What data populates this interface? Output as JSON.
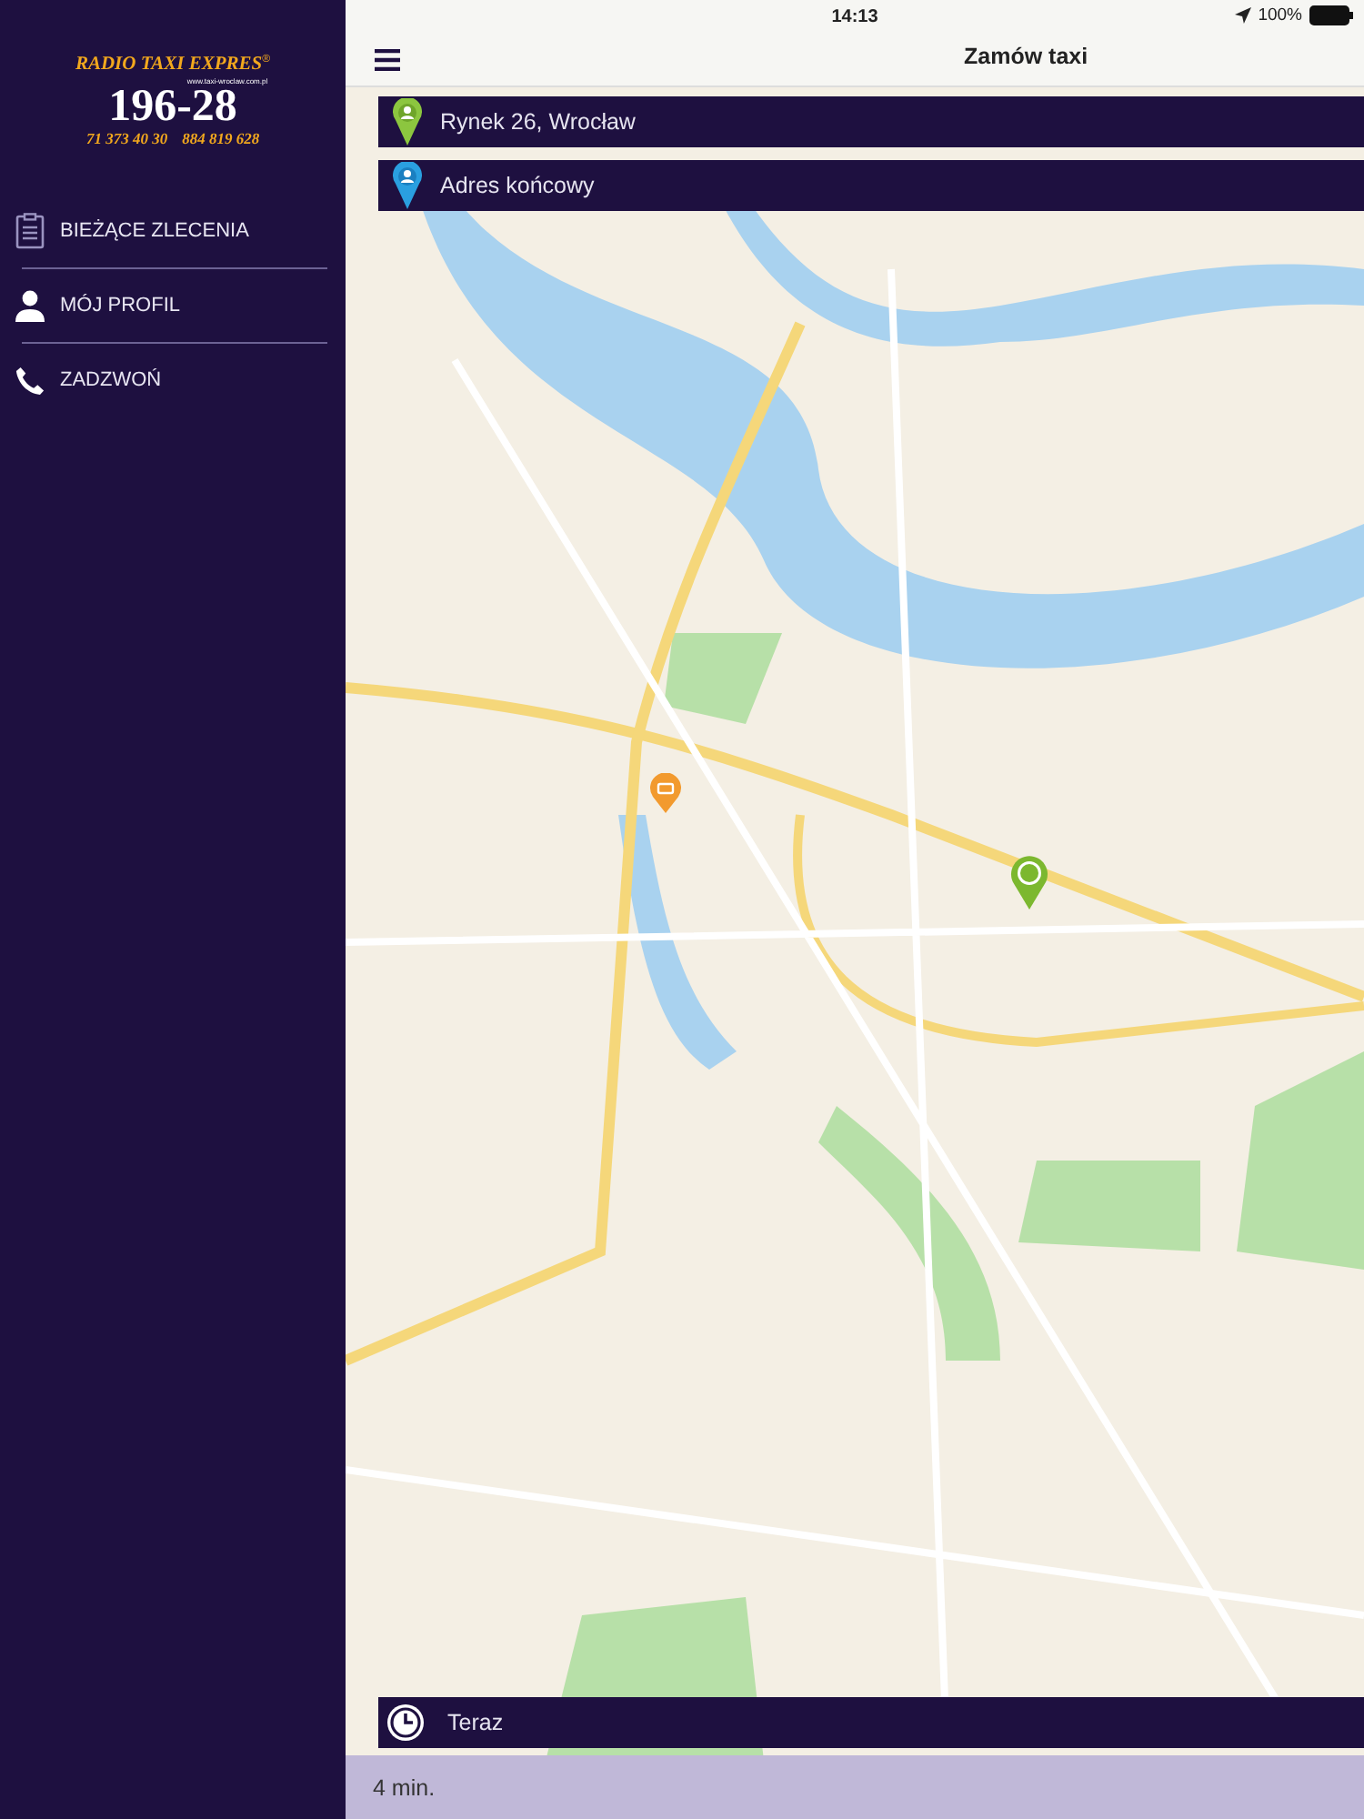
{
  "status_bar": {
    "time": "14:13",
    "battery": "100%"
  },
  "sidebar": {
    "logo": {
      "brand": "RADIO TAXI EXPRES",
      "brand_mark": "®",
      "website": "www.taxi-wroclaw.com.pl",
      "number": "196-28",
      "phones": [
        "71 373 40 30",
        "884 819 628"
      ]
    },
    "items": [
      {
        "kind": "orders",
        "label": "BIEŻĄCE ZLECENIA"
      },
      {
        "kind": "profile",
        "label": "MÓJ PROFIL"
      },
      {
        "kind": "call",
        "label": "ZADZWOŃ"
      }
    ]
  },
  "nav_bar": {
    "title": "Zamów taxi"
  },
  "route": {
    "pickup": {
      "value": "Rynek 26, Wrocław"
    },
    "destination": {
      "placeholder": "Adres końcowy"
    }
  },
  "time_field": {
    "value": "Teraz"
  },
  "eta": "4 min."
}
